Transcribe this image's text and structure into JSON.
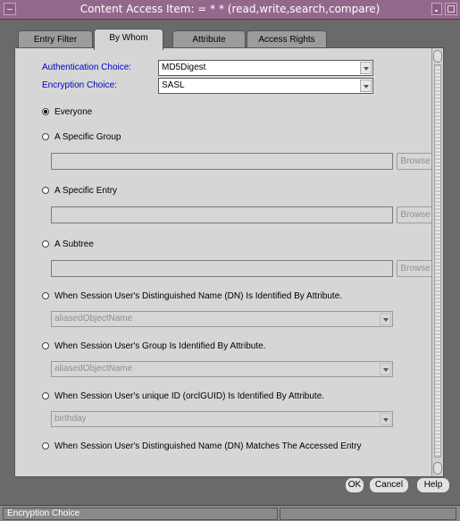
{
  "window": {
    "title": "Content Access Item: = * * (read,write,search,compare)"
  },
  "tabs": [
    {
      "label": "Entry Filter",
      "active": false
    },
    {
      "label": "By Whom",
      "active": true
    },
    {
      "label": "Attribute",
      "active": false
    },
    {
      "label": "Access Rights",
      "active": false
    }
  ],
  "auth": {
    "label": "Authentication Choice:",
    "value": "MD5Digest"
  },
  "encryption": {
    "label": "Encryption Choice:",
    "value": "SASL"
  },
  "options": {
    "everyone": "Everyone",
    "specific_group": "A Specific Group",
    "specific_entry": "A Specific Entry",
    "subtree": "A Subtree",
    "dn_by_attr": "When Session User's Distinguished Name (DN) Is Identified By Attribute.",
    "group_by_attr": "When Session User's Group Is Identified By Attribute.",
    "guid_by_attr": "When Session User's unique ID (orclGUID) Is Identified By Attribute.",
    "dn_matches": "When Session User's Distinguished Name (DN) Matches The Accessed Entry"
  },
  "selected_option": "everyone",
  "browse_label": "Browse",
  "attr_selects": {
    "dn": "aliasedObjectName",
    "group": "aliasedObjectName",
    "guid": "birthday"
  },
  "buttons": {
    "ok": "OK",
    "cancel": "Cancel",
    "help": "Help"
  },
  "status": {
    "text": "Encryption Choice"
  }
}
